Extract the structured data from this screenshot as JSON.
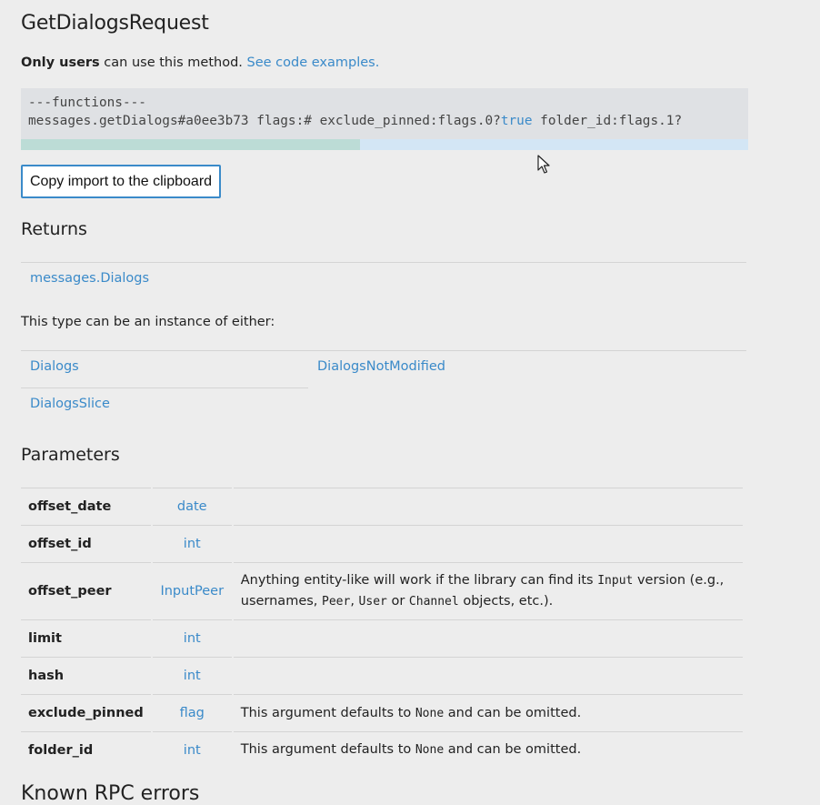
{
  "title": "GetDialogsRequest",
  "intro": {
    "bold": "Only users",
    "text": " can use this method.",
    "link": "See code examples."
  },
  "code": {
    "line1": "---functions---",
    "line2_a": "messages.getDialogs#a0ee3b73 flags:# exclude_pinned:flags.0?",
    "line2_kw": "true",
    "line2_b": " folder_id:flags.1?"
  },
  "copy_button": "Copy import to the clipboard",
  "returns": {
    "heading": "Returns",
    "type_link": "messages.Dialogs",
    "instance_text": "This type can be an instance of either:",
    "instances": [
      "Dialogs",
      "DialogsNotModified",
      "DialogsSlice"
    ]
  },
  "parameters": {
    "heading": "Parameters",
    "rows": [
      {
        "name": "offset_date",
        "type": "date",
        "desc": ""
      },
      {
        "name": "offset_id",
        "type": "int",
        "desc": ""
      },
      {
        "name": "offset_peer",
        "type": "InputPeer",
        "desc": ""
      },
      {
        "name": "limit",
        "type": "int",
        "desc": ""
      },
      {
        "name": "hash",
        "type": "int",
        "desc": ""
      },
      {
        "name": "exclude_pinned",
        "type": "flag",
        "desc": ""
      },
      {
        "name": "folder_id",
        "type": "int",
        "desc": ""
      }
    ],
    "offset_peer_desc": {
      "a": "Anything entity-like will work if the library can find its ",
      "code1": "Input",
      "b": " version (e.g., usernames, ",
      "code2": "Peer",
      "c": ", ",
      "code3": "User",
      "d": " or ",
      "code4": "Channel",
      "e": " objects, etc.)."
    },
    "default_desc": {
      "a": "This argument defaults to ",
      "code": "None",
      "b": " and can be omitted."
    }
  },
  "errors_heading": "Known RPC errors"
}
